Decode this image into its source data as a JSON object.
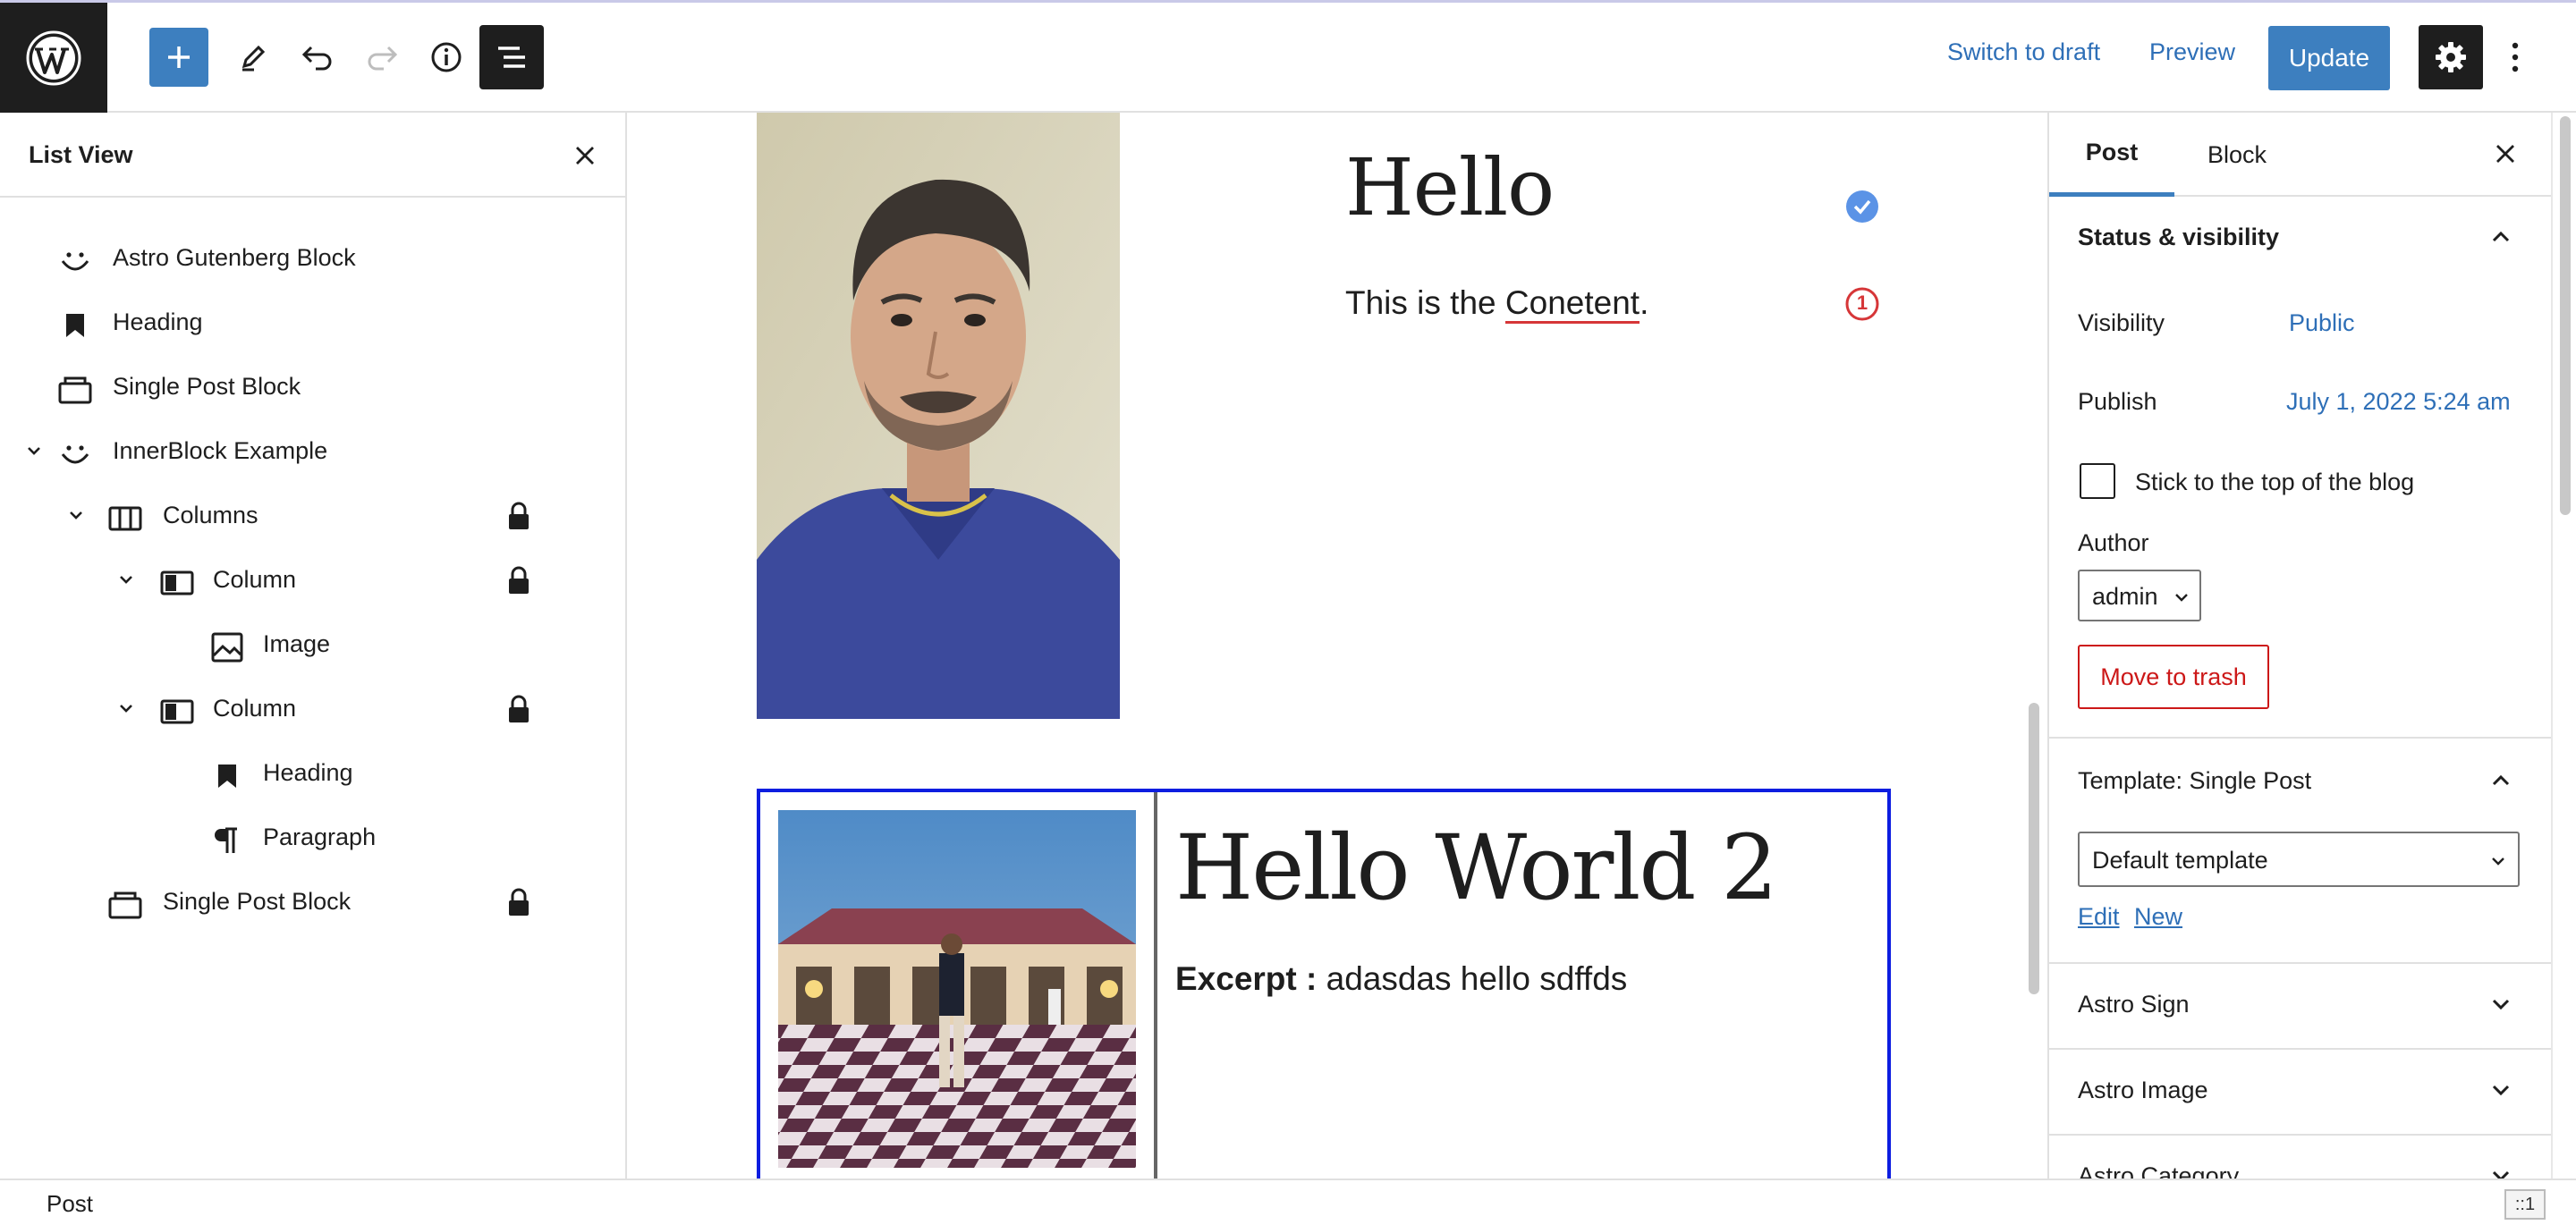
{
  "toolbar": {
    "switch_to_draft": "Switch to draft",
    "preview": "Preview",
    "update": "Update"
  },
  "list_view": {
    "title": "List View",
    "items": [
      {
        "label": "Astro Gutenberg Block",
        "icon": "smiley-icon",
        "expanded": null,
        "locked": false
      },
      {
        "label": "Heading",
        "icon": "bookmark-icon",
        "expanded": null,
        "locked": false
      },
      {
        "label": "Single Post Block",
        "icon": "post-block-icon",
        "expanded": null,
        "locked": false
      },
      {
        "label": "InnerBlock Example",
        "icon": "smiley-icon",
        "expanded": true,
        "locked": false
      },
      {
        "label": "Columns",
        "icon": "columns-icon",
        "expanded": true,
        "locked": true
      },
      {
        "label": "Column",
        "icon": "column-icon",
        "expanded": true,
        "locked": true
      },
      {
        "label": "Image",
        "icon": "image-icon",
        "expanded": null,
        "locked": false
      },
      {
        "label": "Column",
        "icon": "column-icon",
        "expanded": true,
        "locked": true
      },
      {
        "label": "Heading",
        "icon": "bookmark-icon",
        "expanded": null,
        "locked": false
      },
      {
        "label": "Paragraph",
        "icon": "paragraph-icon",
        "expanded": null,
        "locked": false
      },
      {
        "label": "Single Post Block",
        "icon": "post-block-icon",
        "expanded": null,
        "locked": true
      }
    ]
  },
  "canvas": {
    "heading1": "Hello",
    "paragraph_prefix": "This is the ",
    "paragraph_typo": "Conetent",
    "paragraph_suffix": ".",
    "error_count": "1",
    "heading2": "Hello World 2",
    "excerpt_label": "Excerpt :",
    "excerpt_text": " adasdas hello sdffds"
  },
  "sidebar": {
    "tab_post": "Post",
    "tab_block": "Block",
    "status_title": "Status & visibility",
    "visibility_label": "Visibility",
    "visibility_value": "Public",
    "publish_label": "Publish",
    "publish_value": "July 1, 2022 5:24 am",
    "sticky_label": "Stick to the top of the blog",
    "author_label": "Author",
    "author_value": "admin",
    "trash": "Move to trash",
    "template_title": "Template: Single Post",
    "template_value": "Default template",
    "template_edit": "Edit",
    "template_new": "New",
    "panel_astro_sign": "Astro Sign",
    "panel_astro_image": "Astro Image",
    "panel_astro_category": "Astro Category"
  },
  "footer": {
    "breadcrumb": "Post",
    "resize": "::1"
  },
  "colors": {
    "accent": "#3d7fbf",
    "link": "#2e6fb7",
    "danger": "#cc1818",
    "selection": "#0d1de0"
  }
}
